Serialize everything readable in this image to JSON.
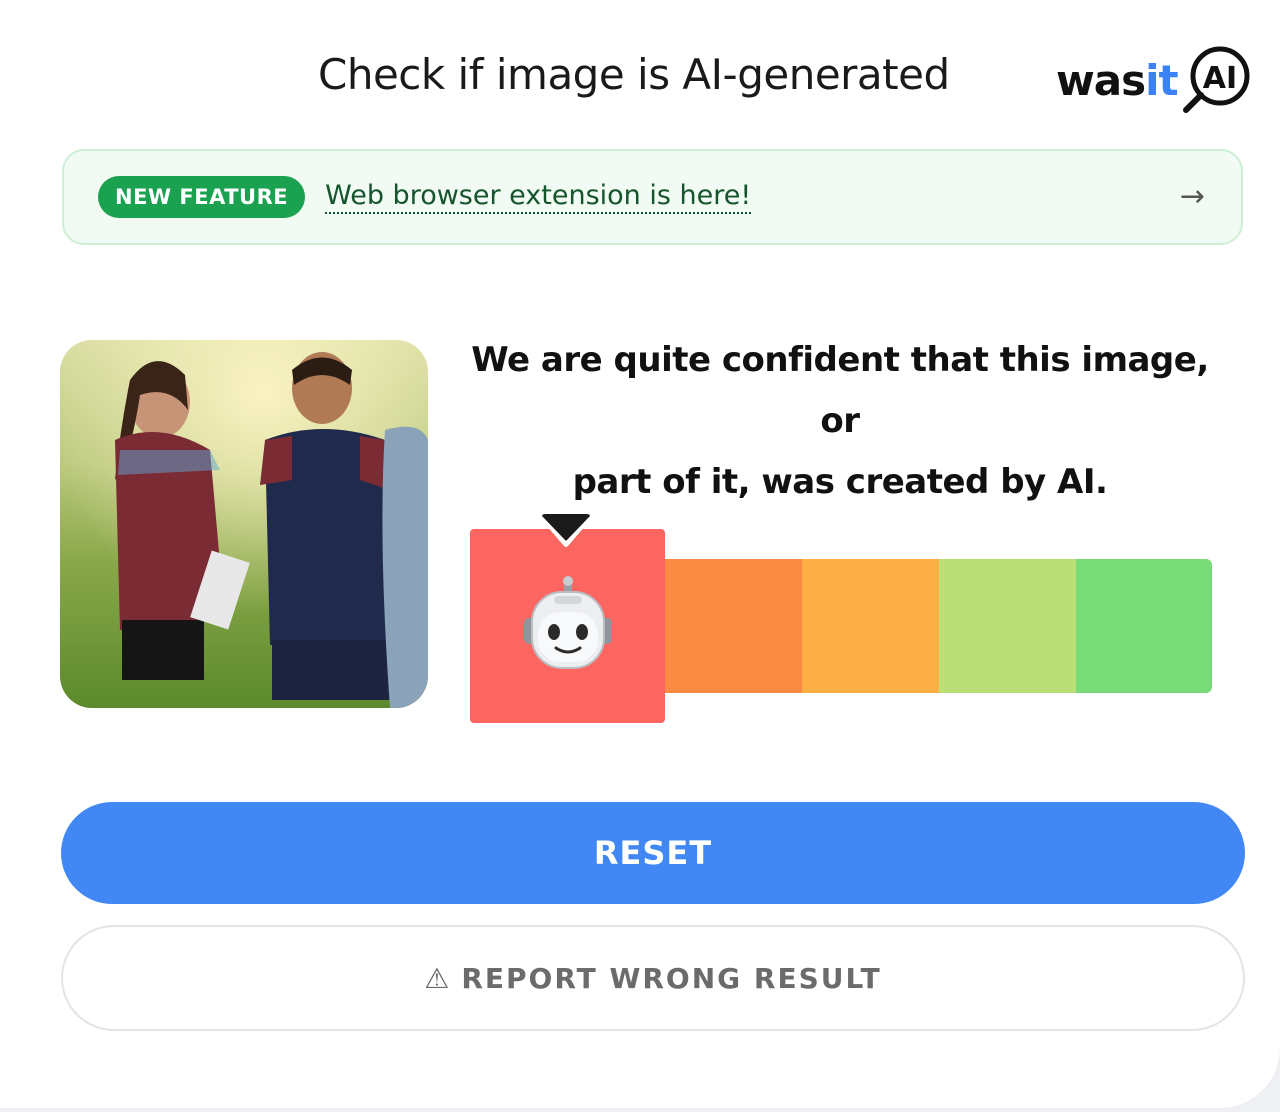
{
  "header": {
    "title": "Check if image is AI-generated",
    "logo_main": "was",
    "logo_accent": "it",
    "logo_suffix": "AI"
  },
  "banner": {
    "badge": "NEW FEATURE",
    "link_text": "Web browser extension is here!",
    "arrow": "→"
  },
  "result": {
    "verdict_line1": "We are quite confident that this image, or",
    "verdict_line2": "part of it, was created by AI.",
    "meter_active_index": 0,
    "meter_colors": [
      "#fc6661",
      "#fb8a43",
      "#fdae45",
      "#badf77",
      "#77db78"
    ],
    "active_icon": "robot-face-icon"
  },
  "actions": {
    "reset_label": "RESET",
    "report_label": "REPORT WRONG RESULT",
    "report_icon": "⚠"
  },
  "colors": {
    "primary": "#4188f4",
    "badge_green": "#1aa251",
    "banner_bg": "#f1fbf3"
  }
}
